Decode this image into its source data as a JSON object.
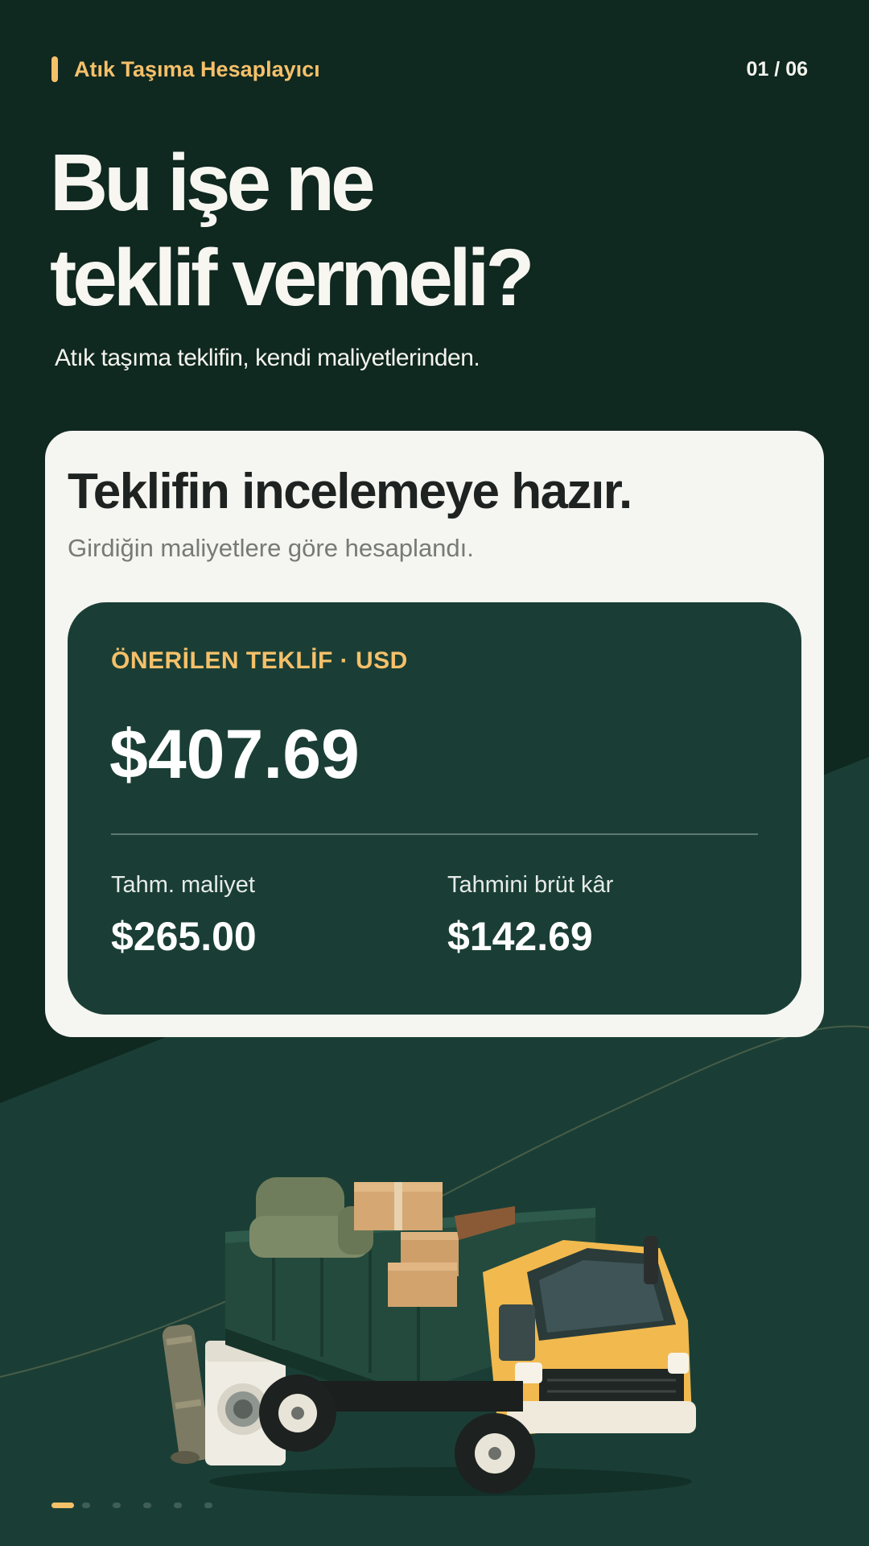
{
  "header": {
    "app_title": "Atık Taşıma Hesaplayıcı",
    "page_counter": "01 / 06"
  },
  "hero": {
    "headline_line1": "Bu işe ne",
    "headline_line2": "teklif vermeli?",
    "subline": "Atık taşıma teklifin, kendi maliyetlerinden."
  },
  "result_card": {
    "title": "Teklifin incelemeye hazır.",
    "subtitle": "Girdiğin maliyetlere göre hesaplandı.",
    "offer_label": "ÖNERİLEN TEKLİF · USD",
    "offer_price": "$407.69",
    "cost_label": "Tahm. maliyet",
    "cost_value": "$265.00",
    "profit_label": "Tahmini brüt kâr",
    "profit_value": "$142.69"
  },
  "pagination": {
    "total": 6,
    "active": 1
  },
  "colors": {
    "background": "#0f2820",
    "lower_background": "#1a3e35",
    "accent": "#f5c06a",
    "card": "#f5f5f1",
    "truck_cab": "#f2b94e",
    "truck_bed": "#234a3d"
  },
  "illustration": "dump-truck-with-furniture-and-boxes"
}
